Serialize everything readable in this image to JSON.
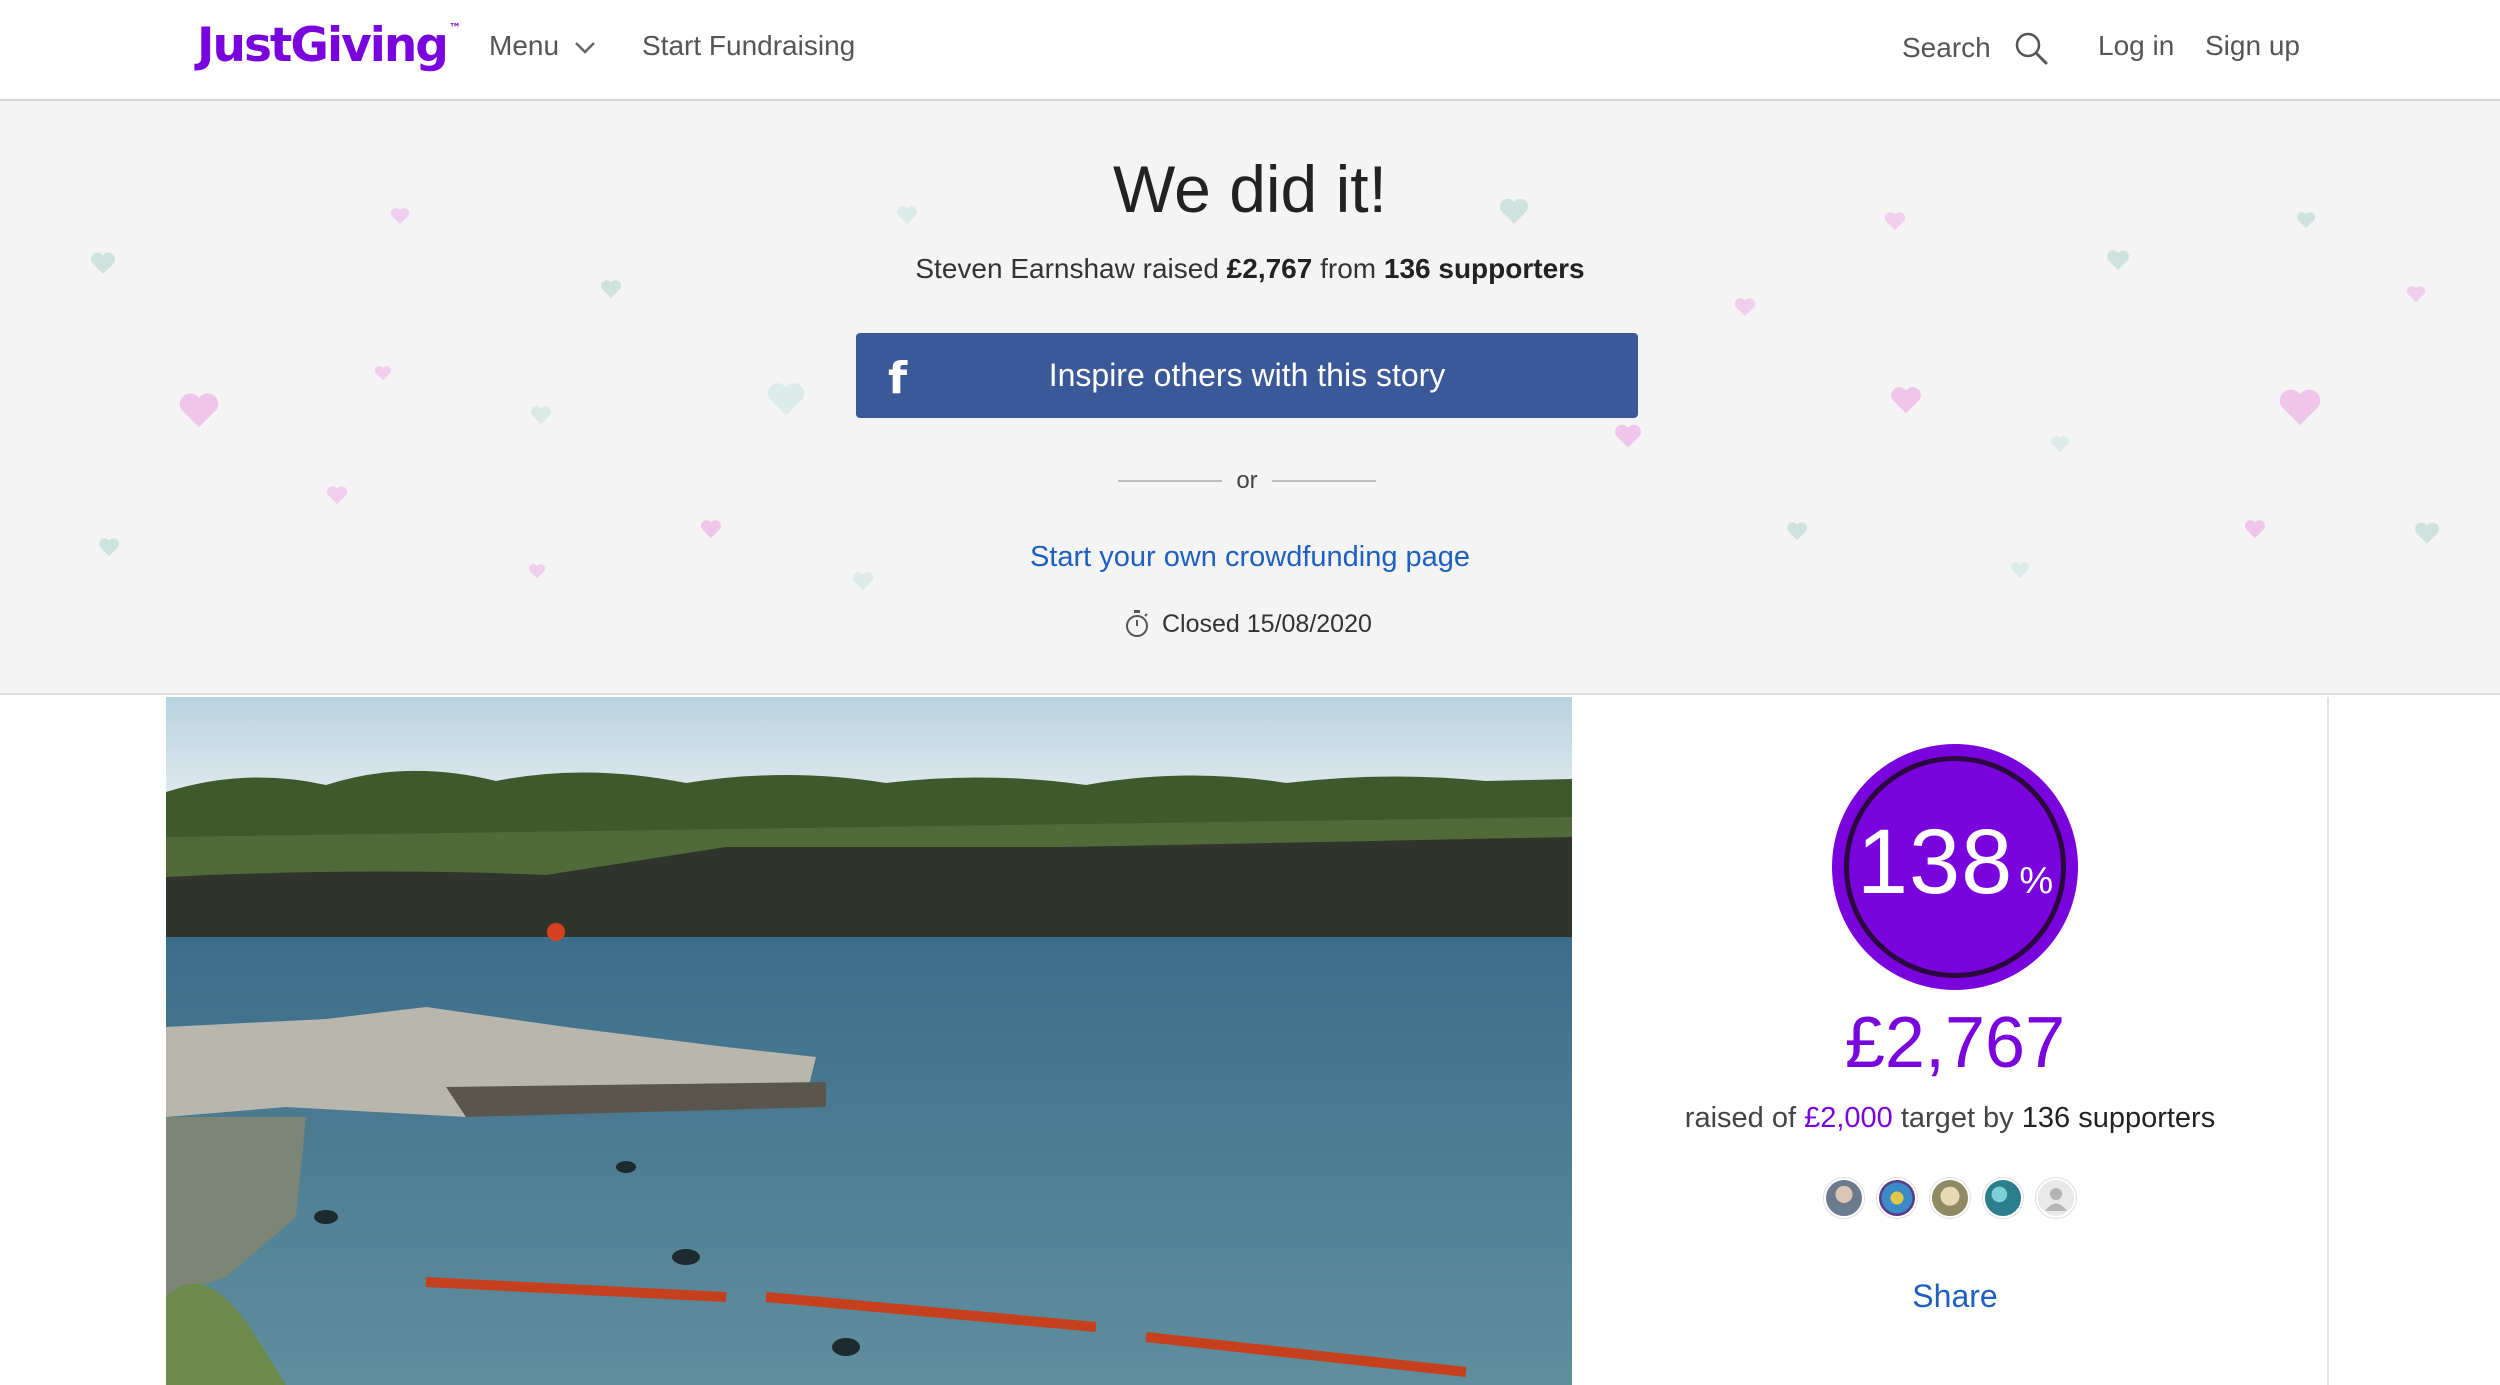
{
  "header": {
    "logo": "JustGiving",
    "logo_tm": "™",
    "menu_label": "Menu",
    "start_fundraising": "Start Fundraising",
    "search_label": "Search",
    "login": "Log in",
    "signup": "Sign up"
  },
  "hero": {
    "title": "We did it!",
    "fundraiser_name": "Steven Earnshaw",
    "raised_word": "raised",
    "raised_amount": "£2,767",
    "from_word": "from",
    "supporters_text": "136 supporters",
    "facebook_button": "Inspire others with this story",
    "or_text": "or",
    "crowdfunding_link": "Start your own crowdfunding page",
    "closed_text": "Closed 15/08/2020"
  },
  "summary": {
    "percent": "138",
    "percent_sign": "%",
    "percent_value": 138,
    "amount": "£2,767",
    "raised_of": "raised of",
    "target": "£2,000",
    "target_by": "target by",
    "supporters": "136 supporters",
    "share": "Share"
  },
  "colors": {
    "brand": "#7a04dd",
    "facebook": "#3b5998",
    "link": "#1f5fbf"
  },
  "icons": [
    "chevron-down-icon",
    "search-icon",
    "facebook-icon",
    "stopwatch-icon",
    "heart-icon"
  ]
}
